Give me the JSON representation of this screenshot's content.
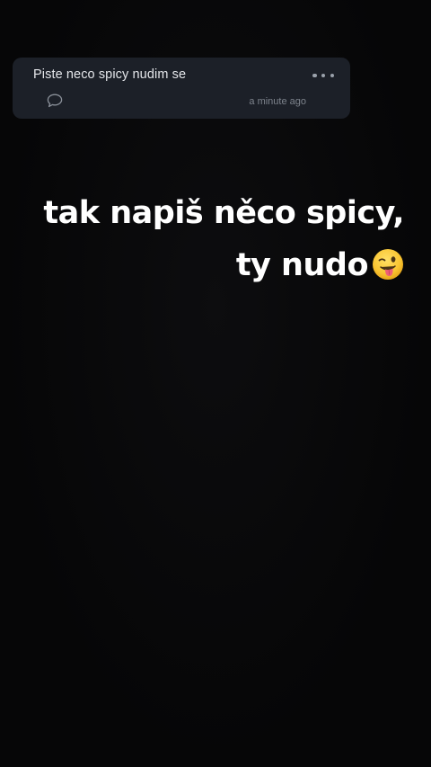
{
  "comment_card": {
    "text": "Piste neco spicy nudim se",
    "timestamp": "a minute ago",
    "more_icon": "more-horizontal-icon",
    "comment_icon": "speech-bubble-icon"
  },
  "caption": {
    "line1": "tak napiš něco spicy,",
    "line2": "ty nudo",
    "emoji": "winking-face-with-tongue"
  },
  "colors": {
    "background": "#070708",
    "card": "#1c2028",
    "text": "#ffffff",
    "muted": "#7d838c"
  }
}
